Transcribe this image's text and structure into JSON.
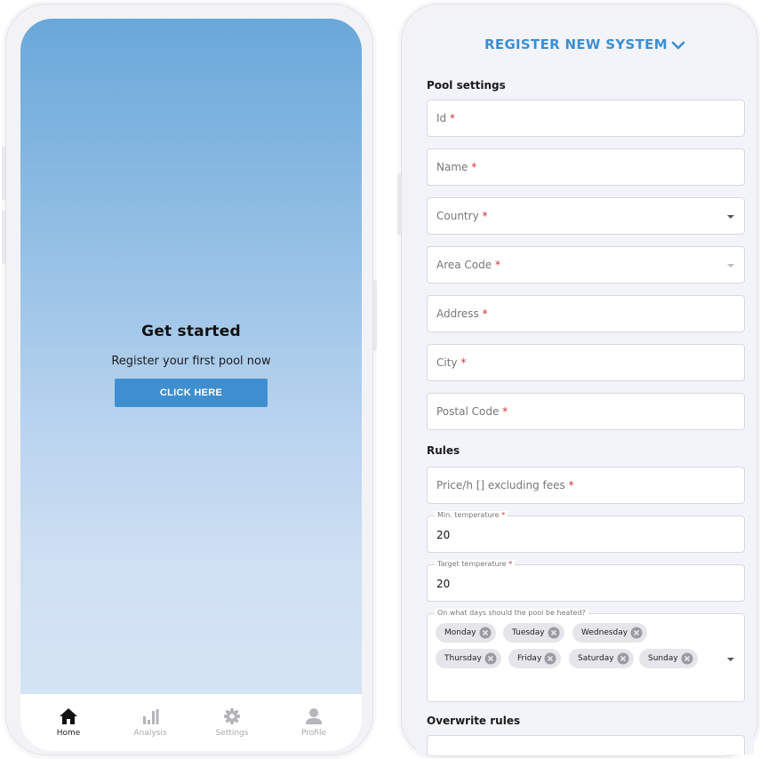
{
  "home": {
    "title": "Get started",
    "subtitle": "Register your first pool now",
    "cta_label": "CLICK HERE",
    "tabs": [
      {
        "label": "Home",
        "icon": "home-icon",
        "active": true
      },
      {
        "label": "Analysis",
        "icon": "bar-chart-icon",
        "active": false
      },
      {
        "label": "Settings",
        "icon": "gear-icon",
        "active": false
      },
      {
        "label": "Profile",
        "icon": "user-icon",
        "active": false
      }
    ]
  },
  "register": {
    "header": "REGISTER NEW SYSTEM",
    "pool_settings_title": "Pool settings",
    "fields": {
      "id": "Id",
      "name": "Name",
      "country": "Country",
      "area_code": "Area Code",
      "address": "Address",
      "city": "City",
      "postal_code": "Postal Code"
    },
    "required_mark": "*",
    "rules_title": "Rules",
    "price_placeholder": "Price/h [] excluding fees",
    "min_temp_label": "Min. temperature",
    "min_temp_value": "20",
    "target_temp_label": "Target temperature",
    "target_temp_value": "20",
    "days_label": "On what days should the pool be heated?",
    "days": [
      "Monday",
      "Tuesday",
      "Wednesday",
      "Thursday",
      "Friday",
      "Saturday",
      "Sunday"
    ],
    "overwrite_title": "Overwrite rules"
  },
  "colors": {
    "accent": "#3b8fd4",
    "cta": "#3f8fd0",
    "required": "#d32f2f",
    "gradient_top": "#6aa8da",
    "gradient_bottom": "#d8e6f5"
  }
}
